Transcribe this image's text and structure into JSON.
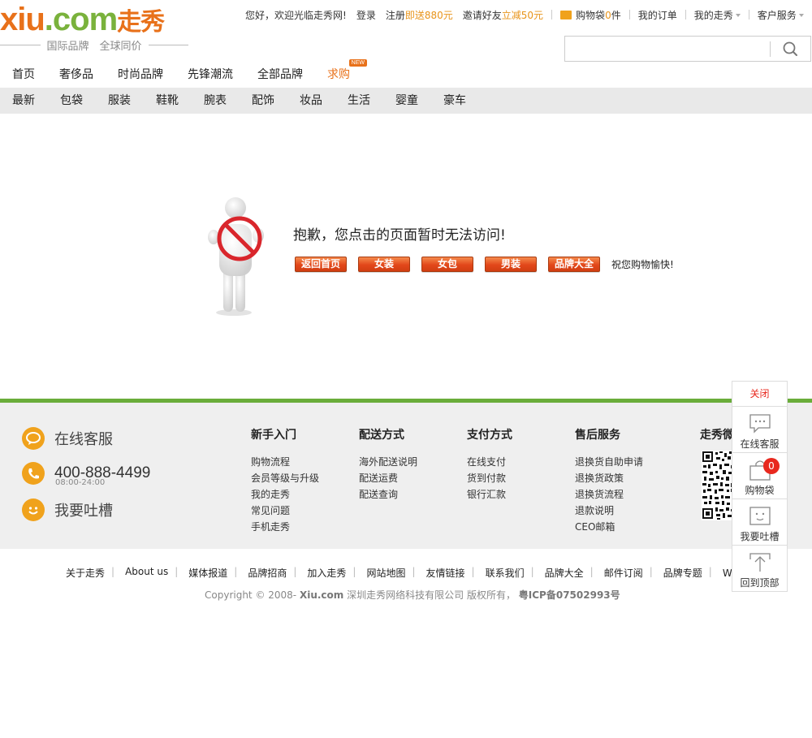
{
  "logo": {
    "x": "xiu",
    "dot": ".",
    "com": "com",
    "cn": "走秀",
    "slogan": "国际品牌　全球同价"
  },
  "topbar": {
    "welcome": "您好，欢迎光临走秀网!",
    "login": "登录",
    "register": "注册",
    "register_bonus": "即送880元",
    "invite": "邀请好友",
    "invite_bonus": "立减50元",
    "cart": "购物袋",
    "cart_count": "0",
    "cart_unit": "件",
    "orders": "我的订单",
    "my_xiu": "我的走秀",
    "service": "客户服务"
  },
  "search": {
    "placeholder": ""
  },
  "main_nav": [
    {
      "label": "首页"
    },
    {
      "label": "奢侈品"
    },
    {
      "label": "时尚品牌"
    },
    {
      "label": "先锋潮流"
    },
    {
      "label": "全部品牌"
    },
    {
      "label": "求购",
      "badge": "NEW"
    }
  ],
  "cat_nav": [
    "最新",
    "包袋",
    "服装",
    "鞋靴",
    "腕表",
    "配饰",
    "妆品",
    "生活",
    "婴童",
    "豪车"
  ],
  "error": {
    "title": "抱歉，您点击的页面暂时无法访问!",
    "buttons": [
      "返回首页",
      "女装",
      "女包",
      "男装",
      "品牌大全"
    ],
    "wish": "祝您购物愉快!"
  },
  "footer": {
    "online_service": "在线客服",
    "phone": "400-888-4499",
    "hours": "08:00-24:00",
    "feedback": "我要吐槽",
    "cols": [
      {
        "title": "新手入门",
        "items": [
          "购物流程",
          "会员等级与升级",
          "我的走秀",
          "常见问题",
          "手机走秀"
        ]
      },
      {
        "title": "配送方式",
        "items": [
          "海外配送说明",
          "配送运费",
          "配送查询"
        ]
      },
      {
        "title": "支付方式",
        "items": [
          "在线支付",
          "货到付款",
          "银行汇款"
        ]
      },
      {
        "title": "售后服务",
        "items": [
          "退换货自助申请",
          "退换货政策",
          "退换货流程",
          "退款说明",
          "CEO邮箱"
        ]
      },
      {
        "title": "走秀微",
        "items": []
      }
    ],
    "links": [
      "关于走秀",
      "About us",
      "媒体报道",
      "品牌招商",
      "加入走秀",
      "网站地图",
      "友情链接",
      "联系我们",
      "品牌大全",
      "邮件订阅",
      "品牌专题",
      "WAP站"
    ],
    "copyright_pre": "Copyright © 2008-",
    "copyright_site": "Xiu.com",
    "copyright_mid": "深圳走秀网络科技有限公司 版权所有，",
    "copyright_icp": "粤ICP备07502993号"
  },
  "side_panel": {
    "close": "关闭",
    "chat": "在线客服",
    "cart": "购物袋",
    "cart_count": "0",
    "feedback": "我要吐槽",
    "top": "回到顶部"
  },
  "colors": {
    "brand_orange": "#e8711a",
    "brand_green": "#6aad3a",
    "accent_red": "#e8281e"
  }
}
